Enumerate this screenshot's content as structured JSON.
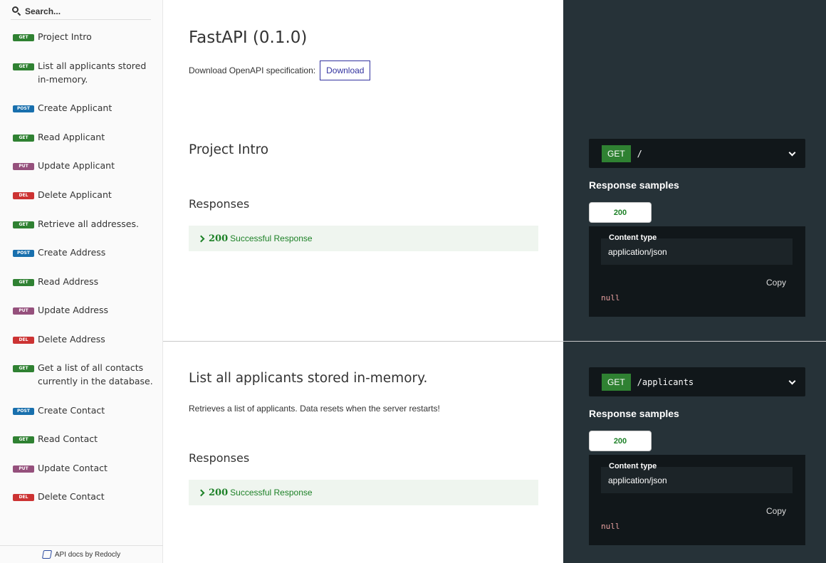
{
  "sidebar": {
    "search_placeholder": "Search...",
    "items": [
      {
        "method": "GET",
        "label": "Project Intro"
      },
      {
        "method": "GET",
        "label": "List all applicants stored in-memory."
      },
      {
        "method": "POST",
        "label": "Create Applicant"
      },
      {
        "method": "GET",
        "label": "Read Applicant"
      },
      {
        "method": "PUT",
        "label": "Update Applicant"
      },
      {
        "method": "DEL",
        "label": "Delete Applicant"
      },
      {
        "method": "GET",
        "label": "Retrieve all addresses."
      },
      {
        "method": "POST",
        "label": "Create Address"
      },
      {
        "method": "GET",
        "label": "Read Address"
      },
      {
        "method": "PUT",
        "label": "Update Address"
      },
      {
        "method": "DEL",
        "label": "Delete Address"
      },
      {
        "method": "GET",
        "label": "Get a list of all contacts currently in the database."
      },
      {
        "method": "POST",
        "label": "Create Contact"
      },
      {
        "method": "GET",
        "label": "Read Contact"
      },
      {
        "method": "PUT",
        "label": "Update Contact"
      },
      {
        "method": "DEL",
        "label": "Delete Contact"
      }
    ],
    "footer": "API docs by Redocly"
  },
  "header": {
    "title": "FastAPI (0.1.0)",
    "download_text": "Download OpenAPI specification:",
    "download_button": "Download"
  },
  "sections": [
    {
      "title": "Project Intro",
      "description": "",
      "responses_heading": "Responses",
      "response_code": "200",
      "response_text": "Successful Response",
      "method": "GET",
      "path": "/",
      "samples_title": "Response samples",
      "sample_tab": "200",
      "content_type_label": "Content type",
      "content_type": "application/json",
      "copy_label": "Copy",
      "sample_body": "null"
    },
    {
      "title": "List all applicants stored in-memory.",
      "description": "Retrieves a list of applicants. Data resets when the server restarts!",
      "responses_heading": "Responses",
      "response_code": "200",
      "response_text": "Successful Response",
      "method": "GET",
      "path": "/applicants",
      "samples_title": "Response samples",
      "sample_tab": "200",
      "content_type_label": "Content type",
      "content_type": "application/json",
      "copy_label": "Copy",
      "sample_body": "null"
    }
  ],
  "colors": {
    "get": "#2f8132",
    "post": "#186fad",
    "put": "#95507c",
    "delete": "#cc3333",
    "dark_panel": "#263238",
    "success_text": "#1d8127"
  }
}
